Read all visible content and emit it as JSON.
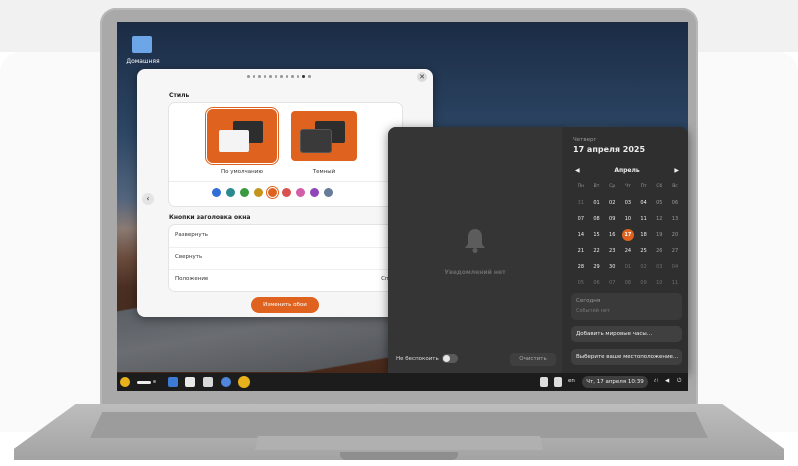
{
  "desktop": {
    "home_label": "Домашняя"
  },
  "settings": {
    "pager": {
      "total": 12,
      "active_index": 10
    },
    "style_title": "Стиль",
    "themes": [
      {
        "label": "По умолчанию",
        "selected": true
      },
      {
        "label": "Темный",
        "selected": false
      }
    ],
    "accent_colors": [
      "#2f6fd6",
      "#2a8a8f",
      "#3a9a42",
      "#c5941c",
      "#e0621f",
      "#d8514f",
      "#d25ea8",
      "#9044b8",
      "#667a99"
    ],
    "selected_accent_index": 4,
    "titlebar_section_title": "Кнопки заголовка окна",
    "rows": [
      {
        "label": "Развернуть"
      },
      {
        "label": "Свернуть"
      },
      {
        "label": "Положение",
        "value": "Справа"
      }
    ],
    "change_button": "Изменить обои"
  },
  "notifications": {
    "empty_text": "Уведомлений нет",
    "dnd_label": "Не беспокоить",
    "dnd_enabled": false,
    "clear_button": "Очистить"
  },
  "calendar": {
    "weekday": "Четверг",
    "date_full": "17 апреля 2025",
    "month": "Апрель",
    "day_headers": [
      "Пн",
      "Вт",
      "Ср",
      "Чт",
      "Пт",
      "Сб",
      "Вс"
    ],
    "weeks": [
      [
        "31",
        "01",
        "02",
        "03",
        "04",
        "05",
        "06"
      ],
      [
        "07",
        "08",
        "09",
        "10",
        "11",
        "12",
        "13"
      ],
      [
        "14",
        "15",
        "16",
        "17",
        "18",
        "19",
        "20"
      ],
      [
        "21",
        "22",
        "23",
        "24",
        "25",
        "26",
        "27"
      ],
      [
        "28",
        "29",
        "30",
        "01",
        "02",
        "03",
        "04"
      ],
      [
        "05",
        "06",
        "07",
        "08",
        "09",
        "10",
        "11"
      ]
    ],
    "today": "17",
    "today_section": "Сегодня",
    "no_events": "Событий нет",
    "add_world_clocks": "Добавить мировые часы…",
    "choose_location": "Выберите ваше местоположение…"
  },
  "taskbar": {
    "language": "en",
    "clock": "Чт, 17 апреля  10:39"
  }
}
